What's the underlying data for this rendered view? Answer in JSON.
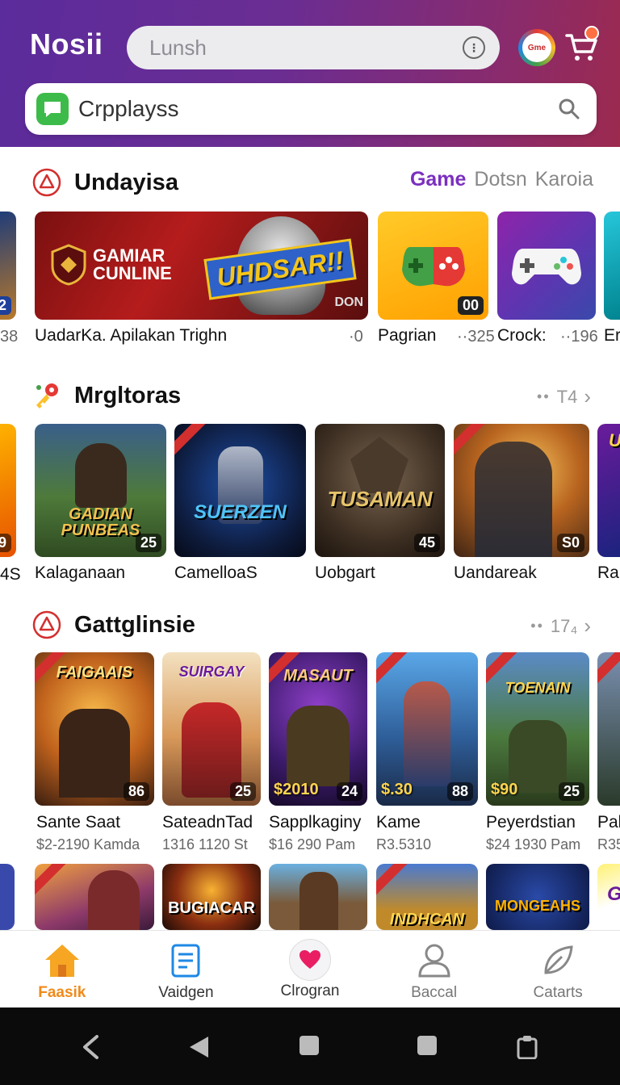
{
  "header": {
    "brand": "Nosii",
    "search_placeholder": "Lunsh",
    "badge_text": "Gme",
    "main_search_text": "Crpplayss"
  },
  "section1": {
    "title": "Undayisa",
    "tab_active": "Game",
    "tab_2": "Dotsn",
    "tab_3": "Karoia",
    "left_edge": {
      "label": "38",
      "num": "2"
    },
    "banner": {
      "line1": "GAMIAR",
      "line2": "CUNLINE",
      "art": "UHDSAR!!",
      "corner": "DON"
    },
    "tile1": {
      "num": "00"
    },
    "caption_main": "UadarKa. Apilakan Trighn",
    "meta1": "·0",
    "tile1_label": "Pagrian",
    "meta2": "··325",
    "tile2_label": "Crock:",
    "meta3": "··196",
    "tile3_label": "Er"
  },
  "section2": {
    "title": "Mrgltoras",
    "more_count": "T4",
    "left_edge": {
      "num": "9",
      "label": "4S"
    },
    "cards": [
      {
        "art": "GADIAN PUNBEAS",
        "num": "25",
        "label": "Kalaganaan"
      },
      {
        "art": "SUERZEN",
        "num": "",
        "label": "CamelloaS"
      },
      {
        "art": "TUSAMAN",
        "num": "45",
        "label": "Uobgart"
      },
      {
        "art": "",
        "num": "S0",
        "label": "Uandareak"
      },
      {
        "art": "U",
        "num": "",
        "label": "Ral"
      }
    ]
  },
  "section3": {
    "title": "Gattglinsie",
    "more_count": "17₄",
    "cards": [
      {
        "art": "FAIGAAIS",
        "price": "",
        "num": "86",
        "label": "Sante Saat",
        "sub": "$2-2190 Kamda"
      },
      {
        "art": "SUIRGAY",
        "price": "",
        "num": "25",
        "label": "SateadnTad",
        "sub": "1316 1120 St"
      },
      {
        "art": "MASAUT",
        "price": "$2010",
        "num": "24",
        "label": "Sapplkaginy",
        "sub": "$16 290 Pam"
      },
      {
        "art": "",
        "price": "$.30",
        "num": "88",
        "label": "Kame",
        "sub": "R3.5310"
      },
      {
        "art": "TOENAIN",
        "price": "$90",
        "num": "25",
        "label": "Peyerdstian",
        "sub": "$24 1930 Pam"
      },
      {
        "art": "",
        "price": "",
        "num": "",
        "label": "Pal",
        "sub": "R35"
      }
    ]
  },
  "row4": {
    "cards": [
      {
        "art": ""
      },
      {
        "art": "BUGIACAR"
      },
      {
        "art": ""
      },
      {
        "art": "INDHCAN"
      },
      {
        "art": "MONGEAHS"
      },
      {
        "art": "G"
      }
    ]
  },
  "bottom_nav": [
    {
      "label": "Faasik",
      "icon": "home-icon"
    },
    {
      "label": "Vaidgen",
      "icon": "list-icon"
    },
    {
      "label": "Clrogran",
      "icon": "heart-icon"
    },
    {
      "label": "Baccal",
      "icon": "profile-icon"
    },
    {
      "label": "Catarts",
      "icon": "leaf-icon"
    }
  ],
  "colors": {
    "header_start": "#5b2c9c",
    "header_end": "#9c2a4e",
    "accent_purple": "#7b2fbf",
    "accent_orange": "#f08a1a"
  }
}
